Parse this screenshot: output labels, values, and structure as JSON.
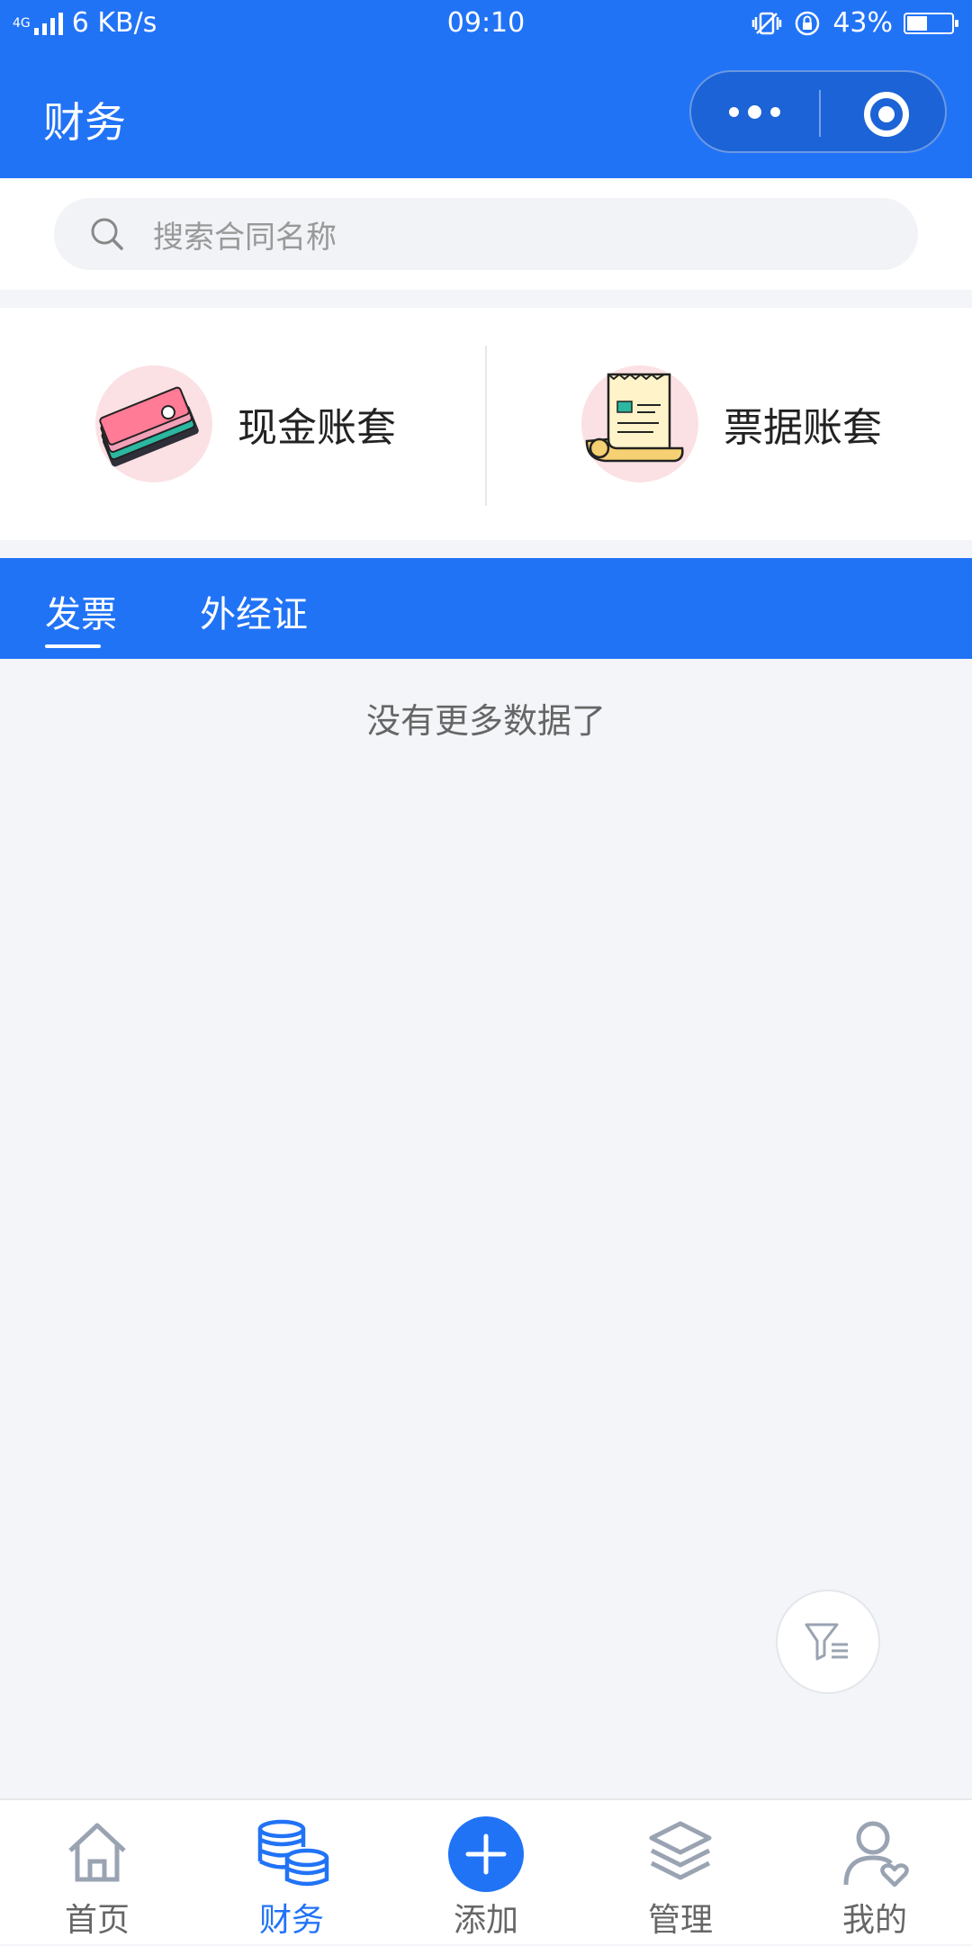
{
  "status_bar": {
    "network": "4G",
    "speed": "6 KB/s",
    "time": "09:10",
    "battery": "43%",
    "battery_level": 0.43
  },
  "header": {
    "title": "财务"
  },
  "search": {
    "placeholder": "搜索合同名称"
  },
  "accounts": [
    {
      "label": "现金账套",
      "icon": "cash-stack-icon"
    },
    {
      "label": "票据账套",
      "icon": "receipt-icon"
    }
  ],
  "tabs": [
    {
      "label": "发票",
      "active": true
    },
    {
      "label": "外经证",
      "active": false
    }
  ],
  "empty_message": "没有更多数据了",
  "bottom_nav": [
    {
      "label": "首页",
      "icon": "home-icon",
      "active": false
    },
    {
      "label": "财务",
      "icon": "coins-icon",
      "active": true
    },
    {
      "label": "添加",
      "icon": "plus-icon",
      "active": false
    },
    {
      "label": "管理",
      "icon": "layers-icon",
      "active": false
    },
    {
      "label": "我的",
      "icon": "user-icon",
      "active": false
    }
  ],
  "colors": {
    "primary": "#2173f6",
    "background": "#f3f5f9",
    "inactive_icon": "#9aa3b2"
  }
}
